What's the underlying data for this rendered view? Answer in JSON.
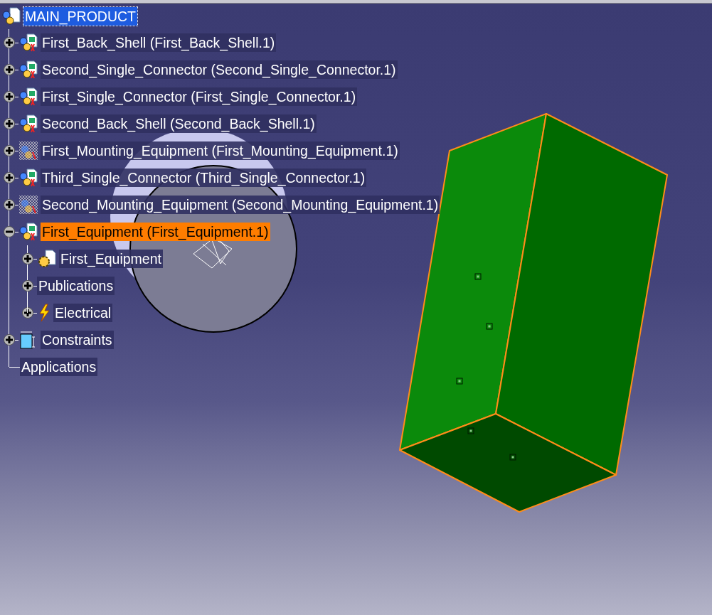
{
  "tree": {
    "label": "MAIN_PRODUCT",
    "kind": "product",
    "active": true,
    "selected": false,
    "children": [
      {
        "label": "First_Back_Shell (First_Back_Shell.1)",
        "kind": "component",
        "expanded": false,
        "active": false,
        "selected": false
      },
      {
        "label": "Second_Single_Connector (Second_Single_Connector.1)",
        "kind": "component",
        "expanded": false,
        "active": false,
        "selected": false
      },
      {
        "label": "First_Single_Connector (First_Single_Connector.1)",
        "kind": "component",
        "expanded": false,
        "active": false,
        "selected": false
      },
      {
        "label": "Second_Back_Shell (Second_Back_Shell.1)",
        "kind": "component",
        "expanded": false,
        "active": false,
        "selected": false
      },
      {
        "label": "First_Mounting_Equipment (First_Mounting_Equipment.1)",
        "kind": "mounting",
        "expanded": false,
        "active": false,
        "selected": false
      },
      {
        "label": "Third_Single_Connector (Third_Single_Connector.1)",
        "kind": "component",
        "expanded": false,
        "active": false,
        "selected": false
      },
      {
        "label": "Second_Mounting_Equipment (Second_Mounting_Equipment.1)",
        "kind": "mounting",
        "expanded": false,
        "active": false,
        "selected": false
      },
      {
        "label": "First_Equipment (First_Equipment.1)",
        "kind": "component",
        "expanded": true,
        "active": false,
        "selected": true,
        "children": [
          {
            "label": "First_Equipment",
            "kind": "part",
            "expanded": false,
            "active": false,
            "selected": false
          },
          {
            "label": "Publications",
            "kind": "plain",
            "expanded": false,
            "active": false,
            "selected": false
          },
          {
            "label": "Electrical",
            "kind": "electrical",
            "expanded": false,
            "active": false,
            "selected": false
          }
        ]
      },
      {
        "label": "Constraints",
        "kind": "constraints",
        "expanded": false,
        "active": false,
        "selected": false
      },
      {
        "label": "Applications",
        "kind": "plain",
        "active": false,
        "selected": false
      }
    ]
  }
}
